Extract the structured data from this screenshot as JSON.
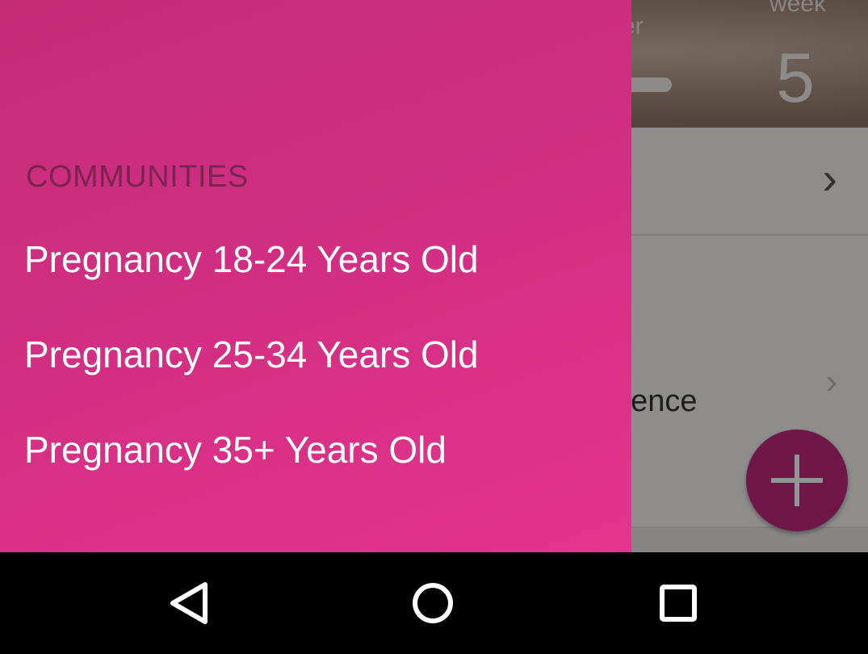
{
  "background_app": {
    "hero_label_partial": "er",
    "hero_week_label": "week",
    "hero_week_number": "5",
    "experience_text_partial": "rience"
  },
  "drawer": {
    "section_title": "COMMUNITIES",
    "items": [
      {
        "label": "Pregnancy 18-24 Years Old"
      },
      {
        "label": "Pregnancy 25-34 Years Old"
      },
      {
        "label": "Pregnancy 35+ Years Old"
      }
    ]
  },
  "fab": {
    "icon": "plus-icon",
    "color": "#c2287f"
  },
  "navbar": {
    "back_icon": "back-triangle-icon",
    "home_icon": "home-circle-icon",
    "recent_icon": "recent-apps-square-icon"
  },
  "colors": {
    "drawer_gradient_start": "#c52c78",
    "drawer_gradient_end": "#e4348d",
    "section_title": "#7a2550"
  }
}
